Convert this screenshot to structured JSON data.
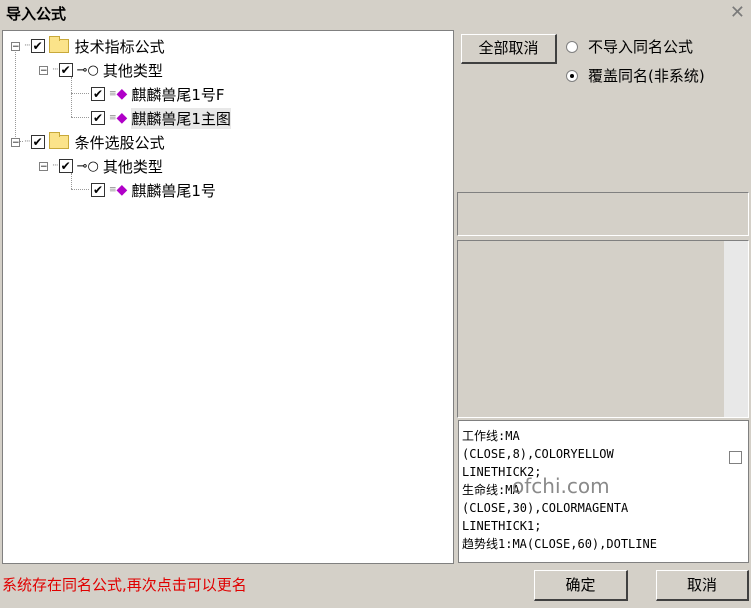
{
  "window": {
    "title": "导入公式",
    "close_glyph": "✕"
  },
  "tree": {
    "nodes": [
      {
        "label": "技术指标公式",
        "checked": true
      },
      {
        "label": "其他类型",
        "checked": true
      },
      {
        "label": "麒麟兽尾1号F",
        "checked": true
      },
      {
        "label": "麒麟兽尾1主图",
        "checked": true
      },
      {
        "label": "条件选股公式",
        "checked": true
      },
      {
        "label": "其他类型",
        "checked": true
      },
      {
        "label": "麒麟兽尾1号",
        "checked": true
      }
    ]
  },
  "controls": {
    "cancel_all_label": "全部取消",
    "radio_options": [
      {
        "label": "不导入同名公式",
        "selected": false
      },
      {
        "label": "覆盖同名(非系统)",
        "selected": true
      }
    ]
  },
  "code": {
    "lines": "工作线:MA\n(CLOSE,8),COLORYELLOW\nLINETHICK2;\n生命线:MA\n(CLOSE,30),COLORMAGENTA\nLINETHICK1;\n趋势线1:MA(CLOSE,60),DOTLINE"
  },
  "watermark": "ofchi.com",
  "status": {
    "message": "系统存在同名公式,再次点击可以更名"
  },
  "footer": {
    "ok_label": "确定",
    "cancel_label": "取消"
  },
  "colors": {
    "status_text": "#e00000",
    "gem": "#b000c8",
    "folder": "#fbe38a"
  }
}
